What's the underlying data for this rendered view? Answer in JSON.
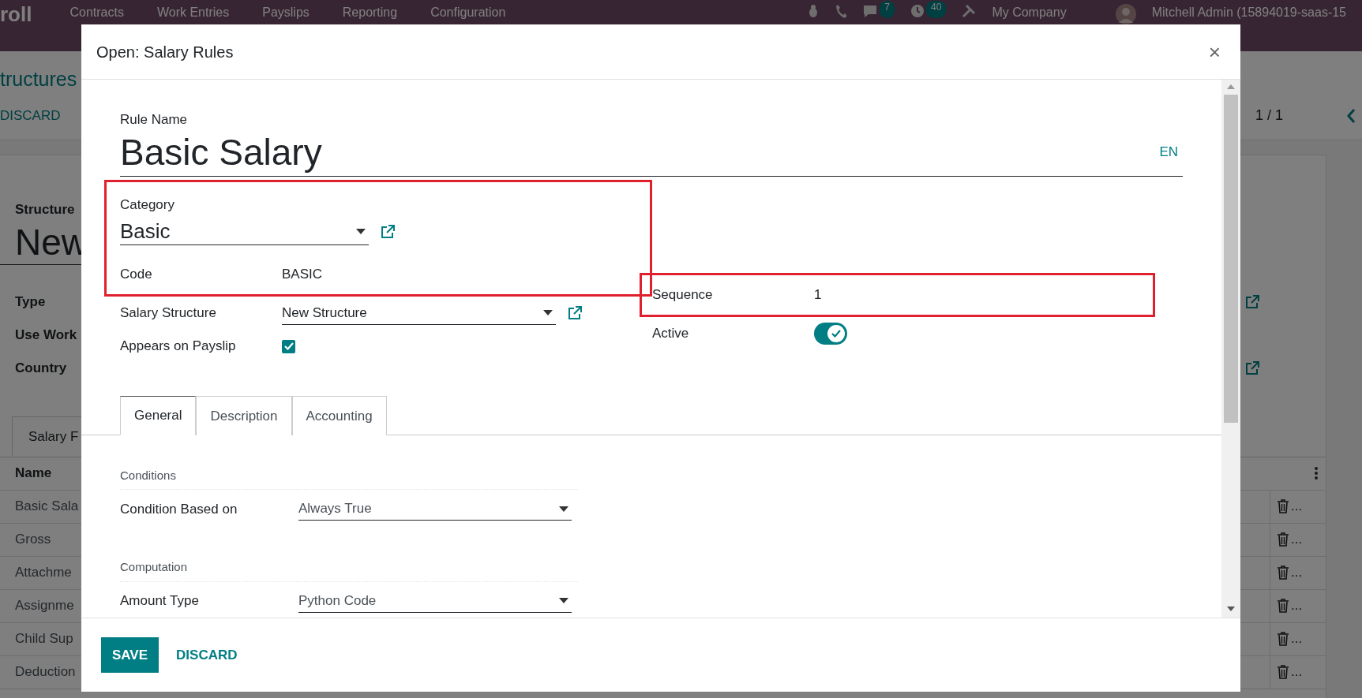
{
  "app_bar": {
    "app_name": "roll",
    "menus": [
      "Contracts",
      "Work Entries",
      "Payslips",
      "Reporting",
      "Configuration"
    ],
    "badges": [
      "7",
      "40"
    ],
    "company": "My Company",
    "user": "Mitchell Admin (15894019-saas-15"
  },
  "background": {
    "breadcrumb": "tructures",
    "discard": "DISCARD",
    "pager": "1 / 1",
    "structure_label": "Structure",
    "structure_name": "New",
    "fields": [
      {
        "label": "Type",
        "link": true
      },
      {
        "label": "Use Work",
        "link": false
      },
      {
        "label": "Country",
        "link": true
      }
    ],
    "tab": "Salary F",
    "column": "Name",
    "rows": [
      {
        "name": "Basic Sala",
        "action": "..."
      },
      {
        "name": "Gross",
        "action": "..."
      },
      {
        "name": "Attachme",
        "action": "..."
      },
      {
        "name": "Assignme",
        "action": "..."
      },
      {
        "name": "Child Sup",
        "action": "..."
      },
      {
        "name": "Deduction",
        "action": "..."
      }
    ]
  },
  "dialog": {
    "title": "Open: Salary Rules",
    "close": "×",
    "rule_name_label": "Rule Name",
    "rule_name": "Basic Salary",
    "language": "EN",
    "left_fields": [
      {
        "kind": "select-large",
        "label": "Category",
        "value": "Basic",
        "link": true,
        "highlighted": true
      },
      {
        "kind": "text",
        "label": "Code",
        "value": "BASIC",
        "highlighted": true
      },
      {
        "kind": "select",
        "label": "Salary Structure",
        "value": "New Structure",
        "link": true,
        "highlighted": false
      },
      {
        "kind": "checkbox",
        "label": "Appears on Payslip",
        "checked": true,
        "highlighted": false
      }
    ],
    "right_fields": [
      {
        "kind": "text",
        "label": "Sequence",
        "value": "1",
        "highlighted": true
      },
      {
        "kind": "toggle",
        "label": "Active",
        "on": true,
        "highlighted": false
      }
    ],
    "tabs": [
      {
        "label": "General",
        "selected": true
      },
      {
        "label": "Description",
        "selected": false
      },
      {
        "label": "Accounting",
        "selected": false
      }
    ],
    "sections": [
      {
        "title": "Conditions",
        "fields": [
          {
            "label": "Condition Based on",
            "value": "Always True"
          }
        ]
      },
      {
        "title": "Computation",
        "fields": [
          {
            "label": "Amount Type",
            "value": "Python Code"
          }
        ]
      }
    ],
    "buttons": [
      {
        "kind": "primary",
        "label": "SAVE"
      },
      {
        "kind": "link",
        "label": "DISCARD"
      }
    ]
  }
}
